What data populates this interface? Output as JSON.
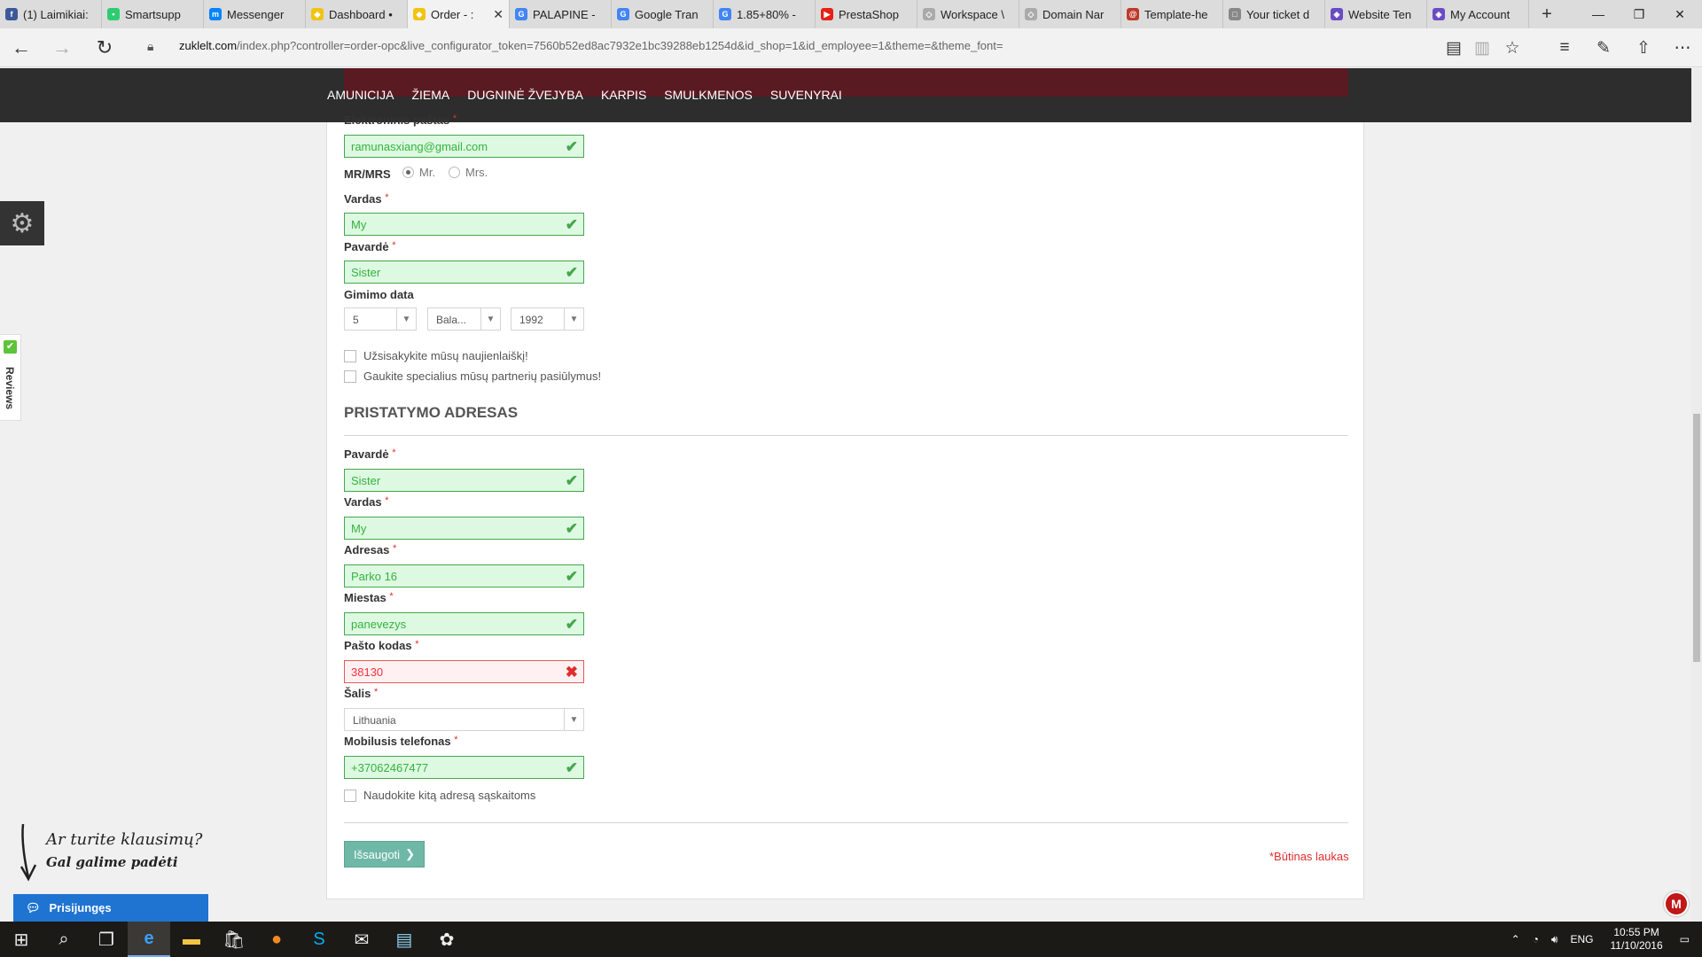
{
  "browser": {
    "tabs": [
      {
        "label": "(1) Laimikiai:",
        "color": "#3b5998",
        "glyph": "f"
      },
      {
        "label": "Smartsupp",
        "color": "#2ecc71",
        "glyph": "•"
      },
      {
        "label": "Messenger",
        "color": "#0084ff",
        "glyph": "m"
      },
      {
        "label": "Dashboard •",
        "color": "#f1c40f",
        "glyph": "◆"
      },
      {
        "label": "Order - :",
        "color": "#f1c40f",
        "glyph": "◆",
        "active": true
      },
      {
        "label": "PALAPINE -",
        "color": "#4285f4",
        "glyph": "G"
      },
      {
        "label": "Google Tran",
        "color": "#4285f4",
        "glyph": "G"
      },
      {
        "label": "1.85+80% -",
        "color": "#4285f4",
        "glyph": "G"
      },
      {
        "label": "PrestaShop",
        "color": "#e62117",
        "glyph": "▶"
      },
      {
        "label": "Workspace \\",
        "color": "#aaa",
        "glyph": "◇"
      },
      {
        "label": "Domain Nar",
        "color": "#aaa",
        "glyph": "◇"
      },
      {
        "label": "Template-he",
        "color": "#c0392b",
        "glyph": "@"
      },
      {
        "label": "Your ticket d",
        "color": "#888",
        "glyph": "□"
      },
      {
        "label": "Website Ten",
        "color": "#6a4bc4",
        "glyph": "◈"
      },
      {
        "label": "My Account",
        "color": "#6a4bc4",
        "glyph": "◈"
      }
    ],
    "url_domain": "zuklelt.com",
    "url_path": "/index.php?controller=order-opc&live_configurator_token=7560b52ed8ac7932e1bc39288eb1254d&id_shop=1&id_employee=1&theme=&theme_font="
  },
  "nav": {
    "items": [
      "AMUNICIJA",
      "ŽIEMA",
      "DUGNINĖ ŽVEJYBA",
      "KARPIS",
      "SMULKMENOS",
      "SUVENYRAI"
    ]
  },
  "form": {
    "email_label": "Elektroninis paštas",
    "email_value": "ramunasxiang@gmail.com",
    "title_label": "MR/MRS",
    "title_mr": "Mr.",
    "title_mrs": "Mrs.",
    "firstname_label": "Vardas",
    "firstname_value": "My",
    "lastname_label": "Pavardė",
    "lastname_value": "Sister",
    "birth_label": "Gimimo data",
    "birth_day": "5",
    "birth_month": "Bala...",
    "birth_year": "1992",
    "newsletter_label": "Užsisakykite mūsų naujienlaiškį!",
    "optin_label": "Gaukite specialius mūsų partnerių pasiūlymus!",
    "delivery_title": "PRISTATYMO ADRESAS",
    "d_lastname_label": "Pavardė",
    "d_lastname_value": "Sister",
    "d_firstname_label": "Vardas",
    "d_firstname_value": "My",
    "address_label": "Adresas",
    "address_value": "Parko 16",
    "city_label": "Miestas",
    "city_value": "panevezys",
    "postcode_label": "Pašto kodas",
    "postcode_value": "38130",
    "country_label": "Šalis",
    "country_value": "Lithuania",
    "phone_label": "Mobilusis telefonas",
    "phone_value": "+37062467477",
    "invoice_label": "Naudokite kitą adresą sąskaitoms",
    "save_label": "Išsaugoti",
    "required_note": "*Būtinas laukas",
    "req_mark": "*"
  },
  "widgets": {
    "reviews_label": "Reviews",
    "help_line1": "Ar turite klausimų?",
    "help_line2": "Gal galime padėti",
    "chat_label": "Prisijungęs",
    "mcafee_glyph": "M"
  },
  "taskbar": {
    "lang": "ENG",
    "time": "10:55 PM",
    "date": "11/10/2016"
  },
  "colors": {
    "valid_border": "#46a74e",
    "valid_bg": "#ddf9e1",
    "error_border": "#e05b5b",
    "button": "#6fb8a8",
    "nav_band": "#2d2d2d"
  }
}
